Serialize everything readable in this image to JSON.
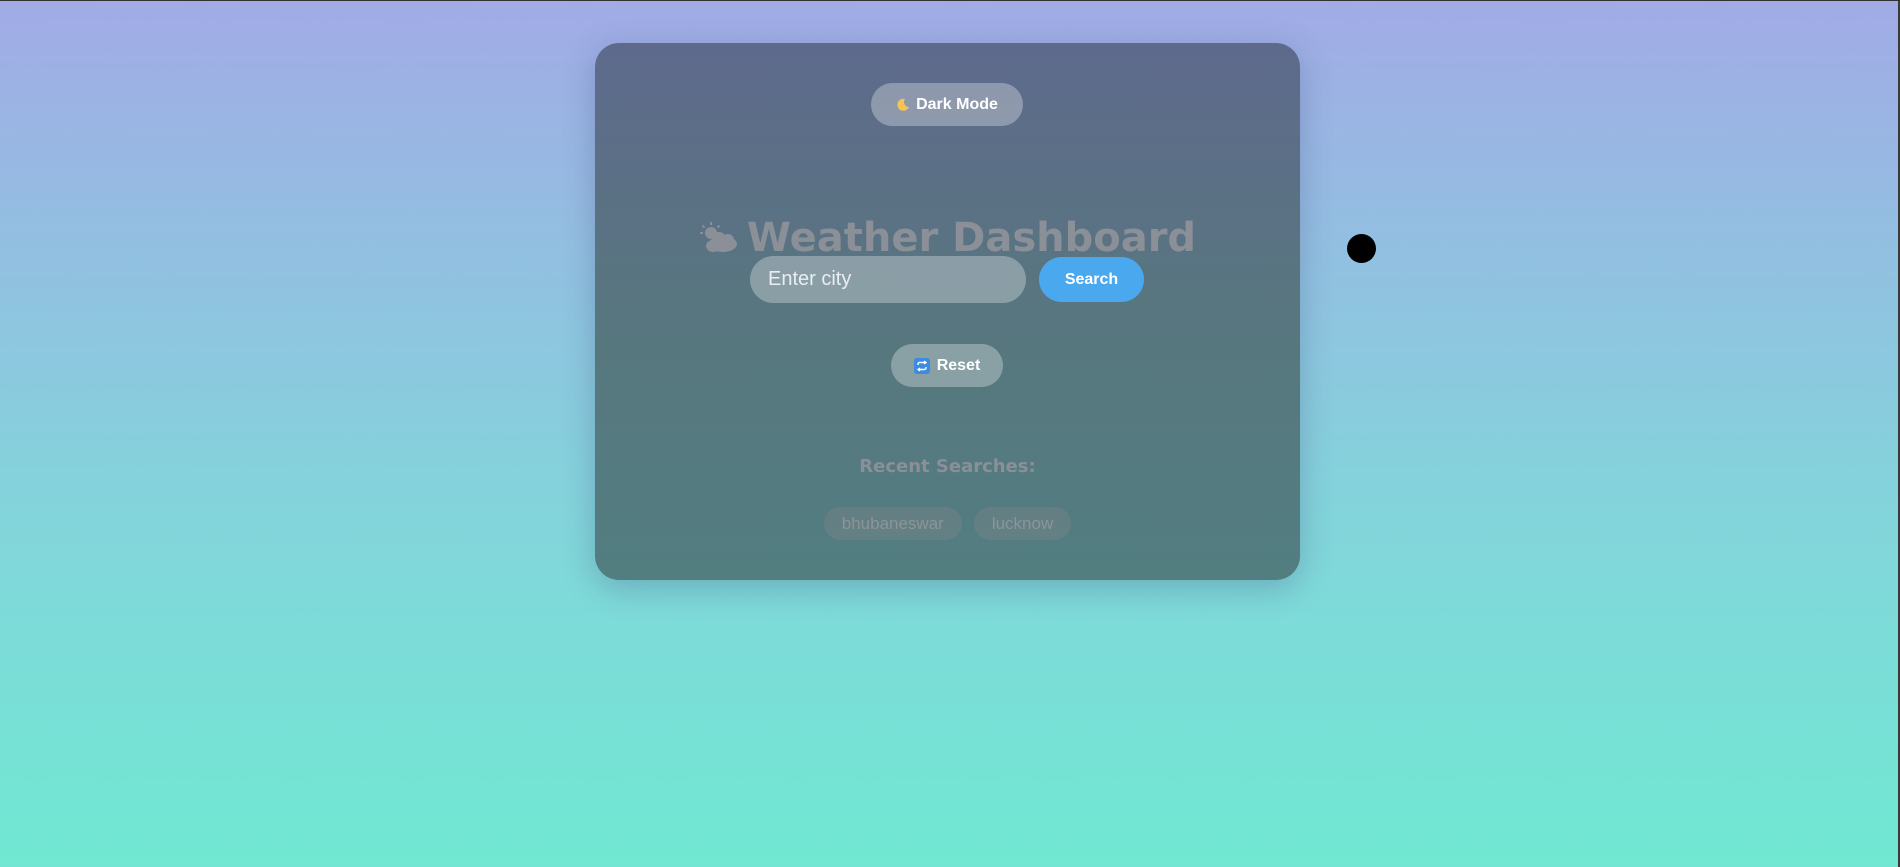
{
  "theme_toggle": {
    "label": "Dark Mode",
    "icon": "moon-icon"
  },
  "header": {
    "title": "Weather Dashboard",
    "icon": "sun-behind-cloud-icon"
  },
  "search": {
    "placeholder": "Enter city",
    "value": "",
    "button_label": "Search"
  },
  "reset": {
    "label": "Reset",
    "icon": "repeat-icon"
  },
  "recent": {
    "heading": "Recent Searches:",
    "items": [
      "bhubaneswar",
      "lucknow"
    ]
  },
  "colors": {
    "search_button": "#4aa8ef",
    "card": "#58767f",
    "background_top": "#a1abe6",
    "background_bottom": "#70e8d2"
  }
}
